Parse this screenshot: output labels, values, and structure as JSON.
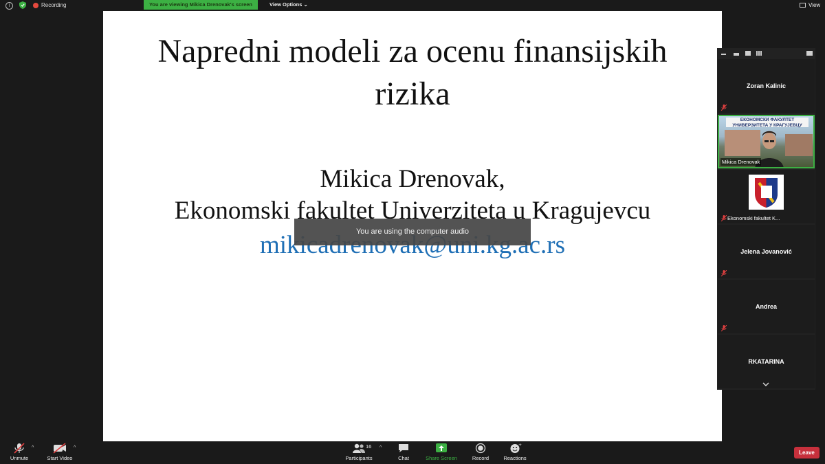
{
  "top_bar": {
    "recording_label": "Recording",
    "viewing_banner": "You are viewing Mikica Drenovak's screen",
    "view_options_label": "View Options",
    "view_label": "View"
  },
  "slide": {
    "title_line1": "Napredni modeli za ocenu finansijskih",
    "title_line2": "rizika",
    "author_line1": "Mikica Drenovak,",
    "author_line2": "Ekonomski fakultet Univerziteta u Kragujevcu",
    "email": "mikicadrenovak@uni.kg.ac.rs"
  },
  "toast": "You are using the computer audio",
  "gallery": {
    "tiles": [
      {
        "name": "Zoran Kalinic"
      },
      {
        "name": "Mikica Drenovak",
        "banner_line1": "ЕКОНОМСКИ ФАКУЛТЕТ",
        "banner_line2": "УНИВЕРЗИТЕТА У КРАГУЈЕВЦУ"
      },
      {
        "name": "Ekonomski fakultet K..."
      },
      {
        "name": "Jelena Jovanović"
      },
      {
        "name": "Andrea"
      },
      {
        "name": "RKATARINA"
      }
    ]
  },
  "bottom_bar": {
    "unmute": "Unmute",
    "start_video": "Start Video",
    "participants": "Participants",
    "participants_count": "16",
    "chat": "Chat",
    "share_screen": "Share Screen",
    "record": "Record",
    "reactions": "Reactions",
    "leave": "Leave"
  },
  "colors": {
    "accent_green": "#3cb043",
    "leave_red": "#c7303c",
    "email_blue": "#1f6fb5"
  }
}
